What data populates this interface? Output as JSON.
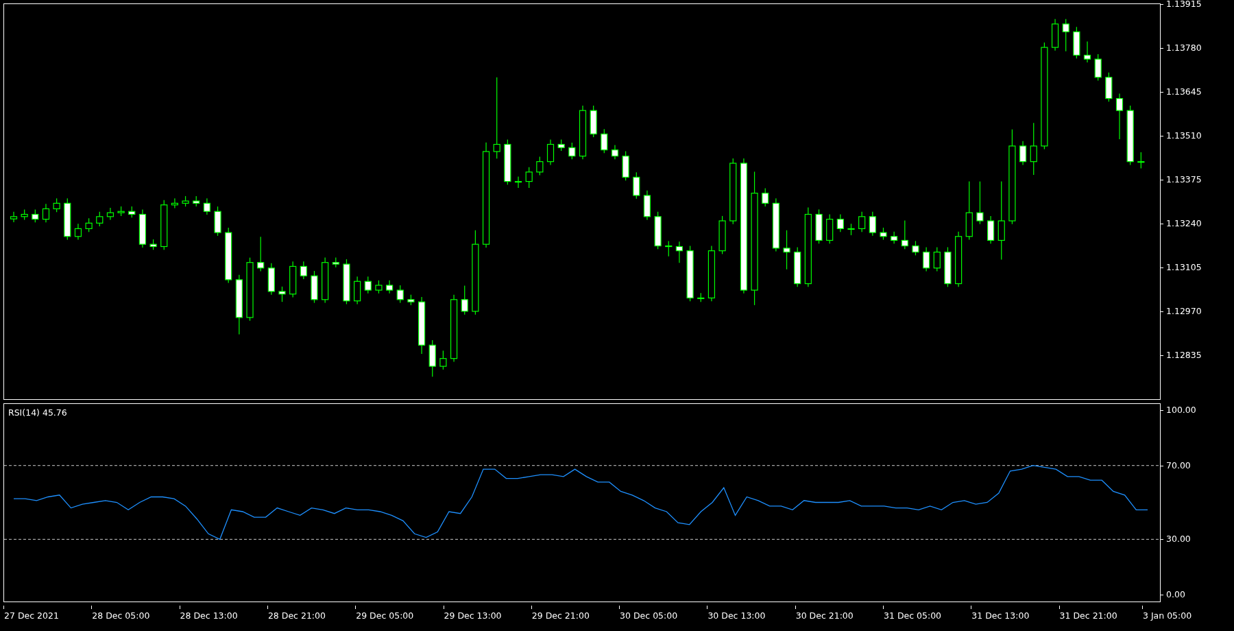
{
  "price_chart": {
    "chart_data": {
      "type": "candlestick",
      "ylim": [
        1.12701,
        1.13915
      ],
      "yticks": [
        {
          "value": 1.13915,
          "label": "1.13915"
        },
        {
          "value": 1.1378,
          "label": "1.13780"
        },
        {
          "value": 1.13645,
          "label": "1.13645"
        },
        {
          "value": 1.1351,
          "label": "1.13510"
        },
        {
          "value": 1.13375,
          "label": "1.13375"
        },
        {
          "value": 1.1324,
          "label": "1.13240"
        },
        {
          "value": 1.13105,
          "label": "1.13105"
        },
        {
          "value": 1.1297,
          "label": "1.12970"
        },
        {
          "value": 1.12835,
          "label": "1.12835"
        }
      ],
      "ohlc": [
        [
          1.13255,
          1.13277,
          1.13245,
          1.13262
        ],
        [
          1.13262,
          1.13284,
          1.13252,
          1.13269
        ],
        [
          1.13269,
          1.13284,
          1.13244,
          1.13254
        ],
        [
          1.13254,
          1.13301,
          1.13244,
          1.13286
        ],
        [
          1.13286,
          1.13318,
          1.13276,
          1.13303
        ],
        [
          1.13303,
          1.13318,
          1.13191,
          1.13201
        ],
        [
          1.13201,
          1.1324,
          1.13191,
          1.13225
        ],
        [
          1.13225,
          1.13257,
          1.13215,
          1.13242
        ],
        [
          1.13242,
          1.13277,
          1.13232,
          1.13262
        ],
        [
          1.13262,
          1.13289,
          1.13252,
          1.13274
        ],
        [
          1.13274,
          1.13293,
          1.13264,
          1.13278
        ],
        [
          1.13278,
          1.13293,
          1.13259,
          1.13269
        ],
        [
          1.13269,
          1.13284,
          1.13167,
          1.13177
        ],
        [
          1.13177,
          1.13192,
          1.1316,
          1.1317
        ],
        [
          1.1317,
          1.13313,
          1.1316,
          1.13298
        ],
        [
          1.13298,
          1.13318,
          1.13288,
          1.13303
        ],
        [
          1.13303,
          1.13325,
          1.13293,
          1.1331
        ],
        [
          1.1331,
          1.13325,
          1.13293,
          1.13303
        ],
        [
          1.13303,
          1.13318,
          1.13268,
          1.13278
        ],
        [
          1.13278,
          1.13293,
          1.13203,
          1.13213
        ],
        [
          1.13213,
          1.13228,
          1.13058,
          1.13068
        ],
        [
          1.13068,
          1.13083,
          1.129,
          1.12952
        ],
        [
          1.12952,
          1.13136,
          1.12942,
          1.13121
        ],
        [
          1.13121,
          1.132,
          1.13094,
          1.13104
        ],
        [
          1.13104,
          1.13119,
          1.13022,
          1.13032
        ],
        [
          1.13032,
          1.13047,
          1.13,
          1.13024
        ],
        [
          1.13024,
          1.13124,
          1.13014,
          1.13109
        ],
        [
          1.13109,
          1.13124,
          1.1307,
          1.1308
        ],
        [
          1.1308,
          1.13095,
          1.12997,
          1.13007
        ],
        [
          1.13007,
          1.13136,
          1.12997,
          1.13121
        ],
        [
          1.13121,
          1.13136,
          1.13106,
          1.13116
        ],
        [
          1.13116,
          1.13131,
          1.12993,
          1.13003
        ],
        [
          1.13003,
          1.13078,
          1.12993,
          1.13063
        ],
        [
          1.13063,
          1.13078,
          1.13026,
          1.13036
        ],
        [
          1.13036,
          1.13066,
          1.13026,
          1.13051
        ],
        [
          1.13051,
          1.13066,
          1.13026,
          1.13036
        ],
        [
          1.13036,
          1.13051,
          1.12997,
          1.13007
        ],
        [
          1.13007,
          1.13022,
          1.1299,
          1.13
        ],
        [
          1.13,
          1.13015,
          1.1284,
          1.12867
        ],
        [
          1.12867,
          1.12882,
          1.1277,
          1.12802
        ],
        [
          1.12802,
          1.1285,
          1.12792,
          1.12826
        ],
        [
          1.12826,
          1.13022,
          1.12816,
          1.13007
        ],
        [
          1.13007,
          1.1305,
          1.12961,
          1.12971
        ],
        [
          1.12971,
          1.1322,
          1.12961,
          1.13177
        ],
        [
          1.13177,
          1.1349,
          1.13167,
          1.13462
        ],
        [
          1.13462,
          1.1369,
          1.1344,
          1.13484
        ],
        [
          1.13484,
          1.13499,
          1.1336,
          1.1337
        ],
        [
          1.1337,
          1.13385,
          1.1335,
          1.1337
        ],
        [
          1.1337,
          1.13414,
          1.1335,
          1.13399
        ],
        [
          1.13399,
          1.13446,
          1.13389,
          1.13431
        ],
        [
          1.13431,
          1.13499,
          1.13421,
          1.13484
        ],
        [
          1.13484,
          1.13499,
          1.13464,
          1.13474
        ],
        [
          1.13474,
          1.13489,
          1.13438,
          1.13448
        ],
        [
          1.13448,
          1.13603,
          1.13438,
          1.13588
        ],
        [
          1.13588,
          1.13603,
          1.13506,
          1.13516
        ],
        [
          1.13516,
          1.13531,
          1.13457,
          1.13467
        ],
        [
          1.13467,
          1.13482,
          1.13438,
          1.13448
        ],
        [
          1.13448,
          1.13463,
          1.13373,
          1.13383
        ],
        [
          1.13383,
          1.13398,
          1.13317,
          1.13327
        ],
        [
          1.13327,
          1.13342,
          1.13252,
          1.13262
        ],
        [
          1.13262,
          1.13277,
          1.13162,
          1.13172
        ],
        [
          1.13172,
          1.13187,
          1.1314,
          1.1317
        ],
        [
          1.1317,
          1.13185,
          1.1312,
          1.13157
        ],
        [
          1.13157,
          1.13172,
          1.13002,
          1.13012
        ],
        [
          1.13012,
          1.13027,
          1.13,
          1.13012
        ],
        [
          1.13012,
          1.13172,
          1.13002,
          1.13157
        ],
        [
          1.13157,
          1.13264,
          1.13147,
          1.13249
        ],
        [
          1.13249,
          1.13441,
          1.13239,
          1.13426
        ],
        [
          1.13426,
          1.13441,
          1.13026,
          1.13036
        ],
        [
          1.13036,
          1.134,
          1.1299,
          1.13334
        ],
        [
          1.13334,
          1.13349,
          1.13293,
          1.13303
        ],
        [
          1.13303,
          1.13318,
          1.13155,
          1.13165
        ],
        [
          1.13165,
          1.1322,
          1.131,
          1.13153
        ],
        [
          1.13153,
          1.13168,
          1.13046,
          1.13056
        ],
        [
          1.13056,
          1.1329,
          1.13046,
          1.13269
        ],
        [
          1.13269,
          1.13284,
          1.13179,
          1.13189
        ],
        [
          1.13189,
          1.13269,
          1.13179,
          1.13254
        ],
        [
          1.13254,
          1.13269,
          1.13215,
          1.13225
        ],
        [
          1.13225,
          1.1324,
          1.13205,
          1.13225
        ],
        [
          1.13225,
          1.13277,
          1.13215,
          1.13262
        ],
        [
          1.13262,
          1.13277,
          1.13203,
          1.13213
        ],
        [
          1.13213,
          1.13228,
          1.13191,
          1.13201
        ],
        [
          1.13201,
          1.13216,
          1.13179,
          1.13189
        ],
        [
          1.13189,
          1.1325,
          1.13162,
          1.13172
        ],
        [
          1.13172,
          1.13187,
          1.13143,
          1.13153
        ],
        [
          1.13153,
          1.13168,
          1.13094,
          1.13104
        ],
        [
          1.13104,
          1.13168,
          1.13094,
          1.13153
        ],
        [
          1.13153,
          1.13168,
          1.13046,
          1.13056
        ],
        [
          1.13056,
          1.13216,
          1.13046,
          1.13201
        ],
        [
          1.13201,
          1.1337,
          1.13191,
          1.13274
        ],
        [
          1.13274,
          1.1337,
          1.13239,
          1.13249
        ],
        [
          1.13249,
          1.13264,
          1.13179,
          1.13189
        ],
        [
          1.13189,
          1.1337,
          1.1313,
          1.13249
        ],
        [
          1.13249,
          1.1353,
          1.13239,
          1.13479
        ],
        [
          1.13479,
          1.13494,
          1.13421,
          1.13431
        ],
        [
          1.13431,
          1.1355,
          1.1339,
          1.13479
        ],
        [
          1.13479,
          1.13797,
          1.13469,
          1.13782
        ],
        [
          1.13782,
          1.13869,
          1.13772,
          1.13854
        ],
        [
          1.13854,
          1.13869,
          1.1377,
          1.1383
        ],
        [
          1.1383,
          1.13845,
          1.13748,
          1.13758
        ],
        [
          1.13758,
          1.138,
          1.13736,
          1.13746
        ],
        [
          1.13746,
          1.13761,
          1.1368,
          1.1369
        ],
        [
          1.1369,
          1.13705,
          1.13615,
          1.13625
        ],
        [
          1.13625,
          1.1364,
          1.135,
          1.13588
        ],
        [
          1.13588,
          1.13603,
          1.13421,
          1.13431
        ],
        [
          1.13431,
          1.1346,
          1.1341,
          1.13431
        ]
      ]
    }
  },
  "rsi_pane": {
    "value": "45.76",
    "chart_data": {
      "type": "line",
      "grid": true,
      "ylim": [
        -3.7,
        103.35
      ],
      "yticks": [
        {
          "value": 100,
          "label": "100.00"
        },
        {
          "value": 70,
          "label": "70.00"
        },
        {
          "value": 30,
          "label": "30.00"
        },
        {
          "value": 0,
          "label": "0.00"
        }
      ],
      "series": [
        {
          "name": "RSI(14)",
          "color": "#1e90ff",
          "values": [
            52,
            52,
            51,
            53,
            54,
            47,
            49,
            50,
            51,
            50,
            46,
            50,
            53,
            53,
            52,
            48,
            41,
            33,
            30,
            46,
            45,
            42,
            42,
            47,
            45,
            43,
            47,
            46,
            44,
            47,
            46,
            46,
            45,
            43,
            40,
            33,
            31,
            34,
            45,
            44,
            53,
            68,
            68,
            63,
            63,
            64,
            65,
            65,
            64,
            68,
            64,
            61,
            61,
            56,
            54,
            51,
            47,
            45,
            39,
            38,
            45,
            50,
            58,
            43,
            53,
            51,
            48,
            48,
            46,
            51,
            50,
            50,
            50,
            51,
            48,
            48,
            48,
            47,
            47,
            46,
            48,
            46,
            50,
            51,
            49,
            50,
            55,
            67,
            68,
            70,
            69,
            68,
            64,
            64,
            62,
            62,
            56,
            54,
            46,
            46
          ]
        }
      ]
    }
  },
  "time_axis": [
    "27 Dec 2021",
    "28 Dec 05:00",
    "28 Dec 13:00",
    "28 Dec 21:00",
    "29 Dec 05:00",
    "29 Dec 13:00",
    "29 Dec 21:00",
    "30 Dec 05:00",
    "30 Dec 13:00",
    "30 Dec 21:00",
    "31 Dec 05:00",
    "31 Dec 13:00",
    "31 Dec 21:00",
    "3 Jan 05:00"
  ]
}
